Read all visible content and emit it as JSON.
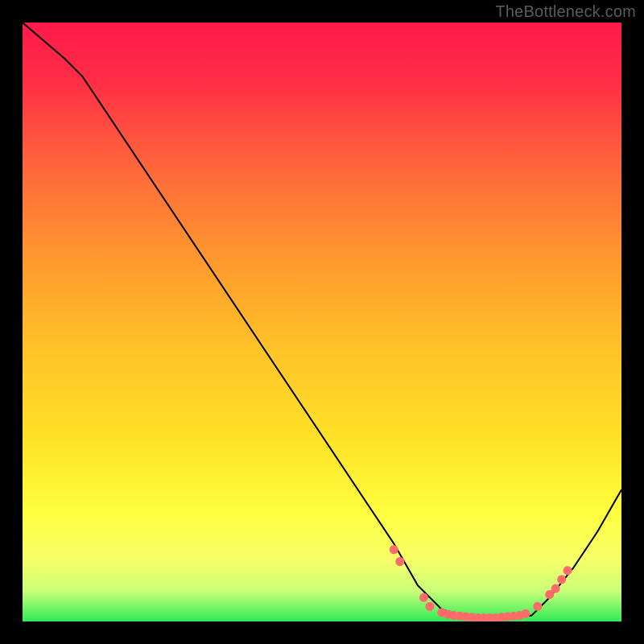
{
  "watermark": "TheBottleneck.com",
  "chart_data": {
    "type": "line",
    "title": "",
    "xlabel": "",
    "ylabel": "",
    "xlim": [
      0,
      100
    ],
    "ylim": [
      0,
      100
    ],
    "grid": false,
    "gradient_stops": [
      {
        "offset": 0.0,
        "color": "#ff1a4a"
      },
      {
        "offset": 0.1,
        "color": "#ff2e46"
      },
      {
        "offset": 0.25,
        "color": "#ff6a3a"
      },
      {
        "offset": 0.4,
        "color": "#ff9a2e"
      },
      {
        "offset": 0.55,
        "color": "#ffc428"
      },
      {
        "offset": 0.7,
        "color": "#ffe327"
      },
      {
        "offset": 0.82,
        "color": "#ffff40"
      },
      {
        "offset": 0.9,
        "color": "#f5ff6a"
      },
      {
        "offset": 0.95,
        "color": "#c8ff78"
      },
      {
        "offset": 1.0,
        "color": "#2fea58"
      }
    ],
    "curve": [
      {
        "x": 0,
        "y": 100
      },
      {
        "x": 7,
        "y": 94
      },
      {
        "x": 10,
        "y": 91
      },
      {
        "x": 20,
        "y": 76
      },
      {
        "x": 30,
        "y": 61
      },
      {
        "x": 40,
        "y": 46
      },
      {
        "x": 50,
        "y": 31
      },
      {
        "x": 58,
        "y": 19
      },
      {
        "x": 62,
        "y": 13
      },
      {
        "x": 66,
        "y": 6
      },
      {
        "x": 70,
        "y": 2
      },
      {
        "x": 75,
        "y": 0.5
      },
      {
        "x": 80,
        "y": 0.5
      },
      {
        "x": 85,
        "y": 1
      },
      {
        "x": 88,
        "y": 4
      },
      {
        "x": 92,
        "y": 9
      },
      {
        "x": 96,
        "y": 15
      },
      {
        "x": 100,
        "y": 22
      }
    ],
    "markers": [
      {
        "x": 62,
        "y": 12
      },
      {
        "x": 63,
        "y": 10
      },
      {
        "x": 67,
        "y": 4
      },
      {
        "x": 68,
        "y": 2.5
      },
      {
        "x": 70,
        "y": 1.5
      },
      {
        "x": 71,
        "y": 1.2
      },
      {
        "x": 72,
        "y": 1.0
      },
      {
        "x": 73,
        "y": 0.9
      },
      {
        "x": 74,
        "y": 0.8
      },
      {
        "x": 75,
        "y": 0.7
      },
      {
        "x": 76,
        "y": 0.6
      },
      {
        "x": 77,
        "y": 0.6
      },
      {
        "x": 78,
        "y": 0.6
      },
      {
        "x": 79,
        "y": 0.6
      },
      {
        "x": 80,
        "y": 0.7
      },
      {
        "x": 81,
        "y": 0.8
      },
      {
        "x": 82,
        "y": 0.9
      },
      {
        "x": 83,
        "y": 1.0
      },
      {
        "x": 84,
        "y": 1.3
      },
      {
        "x": 86,
        "y": 2.5
      },
      {
        "x": 88,
        "y": 4.5
      },
      {
        "x": 89,
        "y": 5.5
      },
      {
        "x": 90,
        "y": 7
      },
      {
        "x": 91,
        "y": 8.5
      }
    ],
    "marker_color": "#ff6b6b",
    "curve_color": "#000000"
  }
}
